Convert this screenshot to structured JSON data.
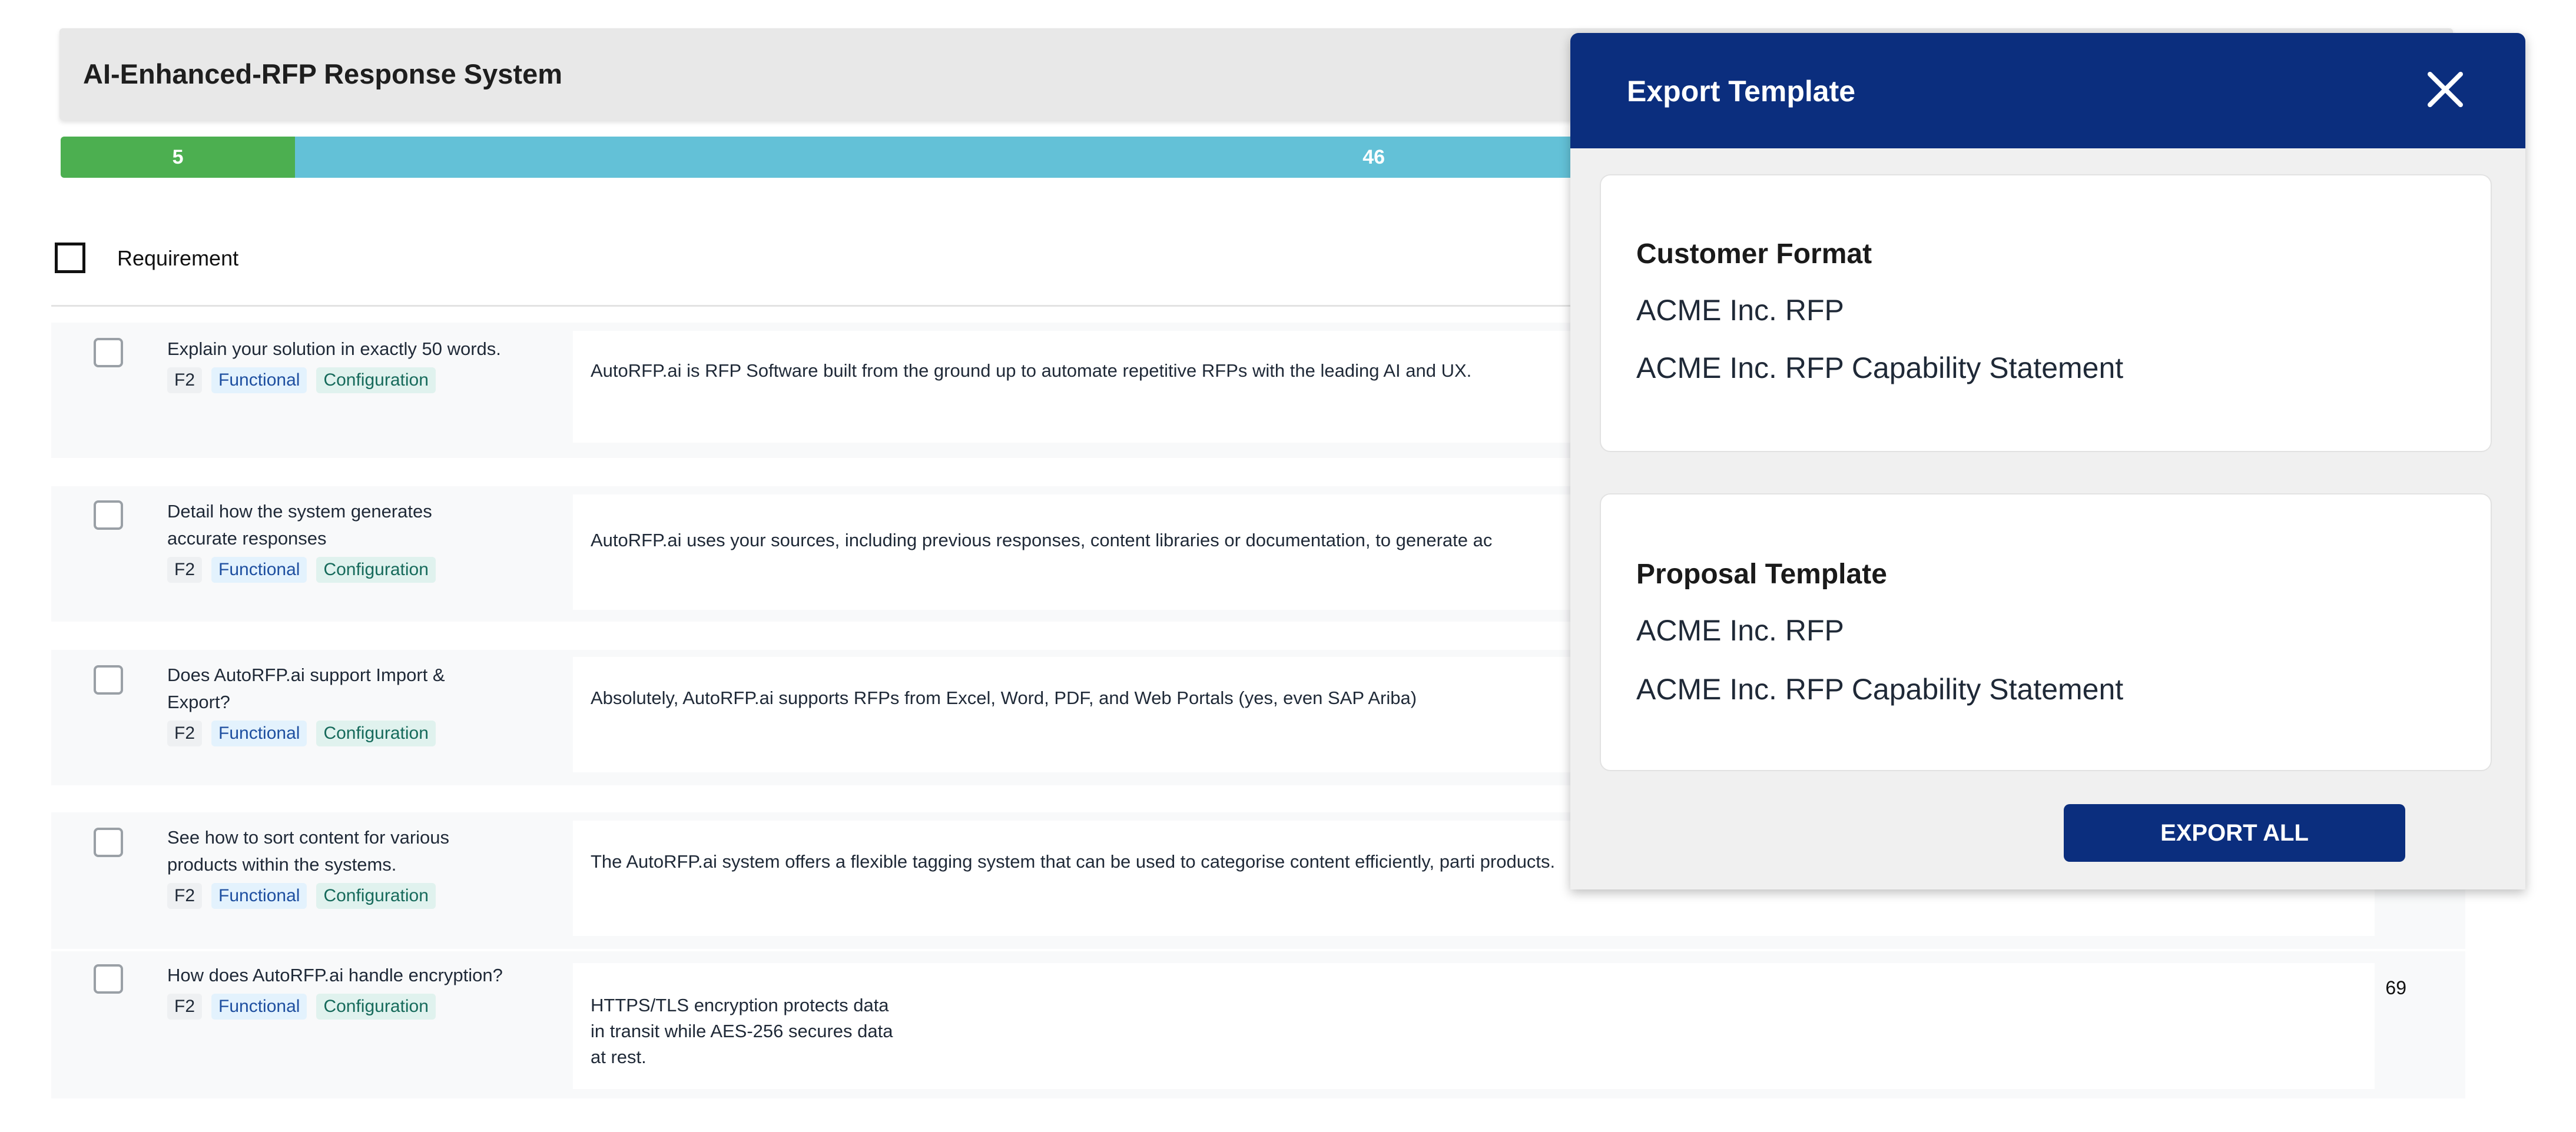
{
  "app": {
    "title": "AI-Enhanced-RFP Response System"
  },
  "progress": {
    "segments": [
      {
        "label": "5",
        "value": 5,
        "color": "#4caf50"
      },
      {
        "label": "46",
        "value": 46,
        "color": "#63c1d7"
      }
    ]
  },
  "table": {
    "header": {
      "requirement": "Requirement"
    },
    "rows": [
      {
        "requirement": "Explain your solution in exactly 50 words.",
        "tags": [
          "F2",
          "Functional",
          "Configuration"
        ],
        "answer": "AutoRFP.ai is RFP Software built from the ground up to automate repetitive RFPs with the leading AI and UX."
      },
      {
        "requirement": "Detail how the system generates accurate responses",
        "tags": [
          "F2",
          "Functional",
          "Configuration"
        ],
        "answer": "AutoRFP.ai uses your sources, including previous responses, content libraries or documentation, to generate ac"
      },
      {
        "requirement": "Does AutoRFP.ai support Import & Export?",
        "tags": [
          "F2",
          "Functional",
          "Configuration"
        ],
        "answer": "Absolutely, AutoRFP.ai supports RFPs from Excel, Word, PDF, and Web Portals (yes, even SAP Ariba)"
      },
      {
        "requirement": "See how to sort content for various products within the systems.",
        "tags": [
          "F2",
          "Functional",
          "Configuration"
        ],
        "answer": "The AutoRFP.ai system offers a flexible tagging system that can be used to categorise content efficiently, parti products."
      },
      {
        "requirement": "How does AutoRFP.ai handle encryption?",
        "tags": [
          "F2",
          "Functional",
          "Configuration"
        ],
        "answer": "HTTPS/TLS encryption protects data in transit while AES-256 secures data at rest.",
        "score": "69"
      }
    ]
  },
  "export_panel": {
    "title": "Export Template",
    "close_icon": "close-icon",
    "customer_format": {
      "title": "Customer Format",
      "items": [
        "ACME Inc. RFP",
        "ACME Inc. RFP Capability Statement"
      ]
    },
    "proposal_template": {
      "title": "Proposal Template",
      "items": [
        "ACME Inc. RFP",
        "ACME Inc. RFP Capability Statement"
      ]
    },
    "export_all_label": "EXPORT ALL"
  },
  "colors": {
    "primary": "#0b2e7e",
    "done": "#4caf50",
    "in_progress": "#63c1d7"
  }
}
